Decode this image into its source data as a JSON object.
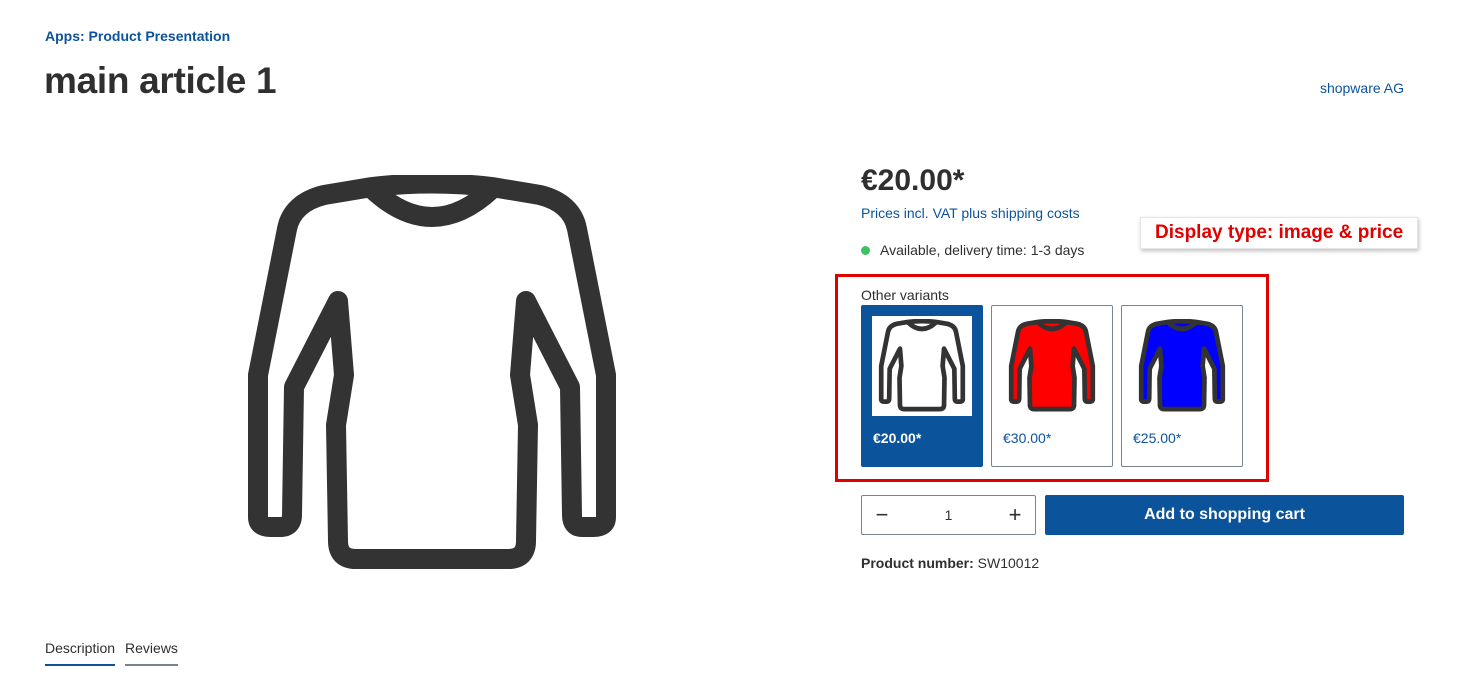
{
  "breadcrumb": "Apps: Product Presentation",
  "product": {
    "title": "main article 1",
    "manufacturer": "shopware AG",
    "price": "€20.00*",
    "tax_note": "Prices incl. VAT plus shipping costs",
    "delivery": "Available, delivery time: 1-3 days",
    "product_number_label": "Product number:",
    "product_number": "SW10012"
  },
  "annotation": "Display type: image & price",
  "variants": {
    "label": "Other variants",
    "items": [
      {
        "price": "€20.00*",
        "color": "#ffffff",
        "selected": true
      },
      {
        "price": "€30.00*",
        "color": "#ff0000",
        "selected": false
      },
      {
        "price": "€25.00*",
        "color": "#0000ff",
        "selected": false
      }
    ]
  },
  "buy": {
    "quantity": "1",
    "minus": "−",
    "plus": "+",
    "add_to_cart": "Add to shopping cart"
  },
  "tabs": [
    {
      "label": "Description",
      "active": true
    },
    {
      "label": "Reviews",
      "active": false
    }
  ],
  "colors": {
    "brand": "#0b539b",
    "annotation": "#e00000",
    "available": "#3cc261"
  },
  "icons": {
    "main_image": "longsleeve-shirt-icon",
    "delivery": "availability-dot-icon"
  }
}
